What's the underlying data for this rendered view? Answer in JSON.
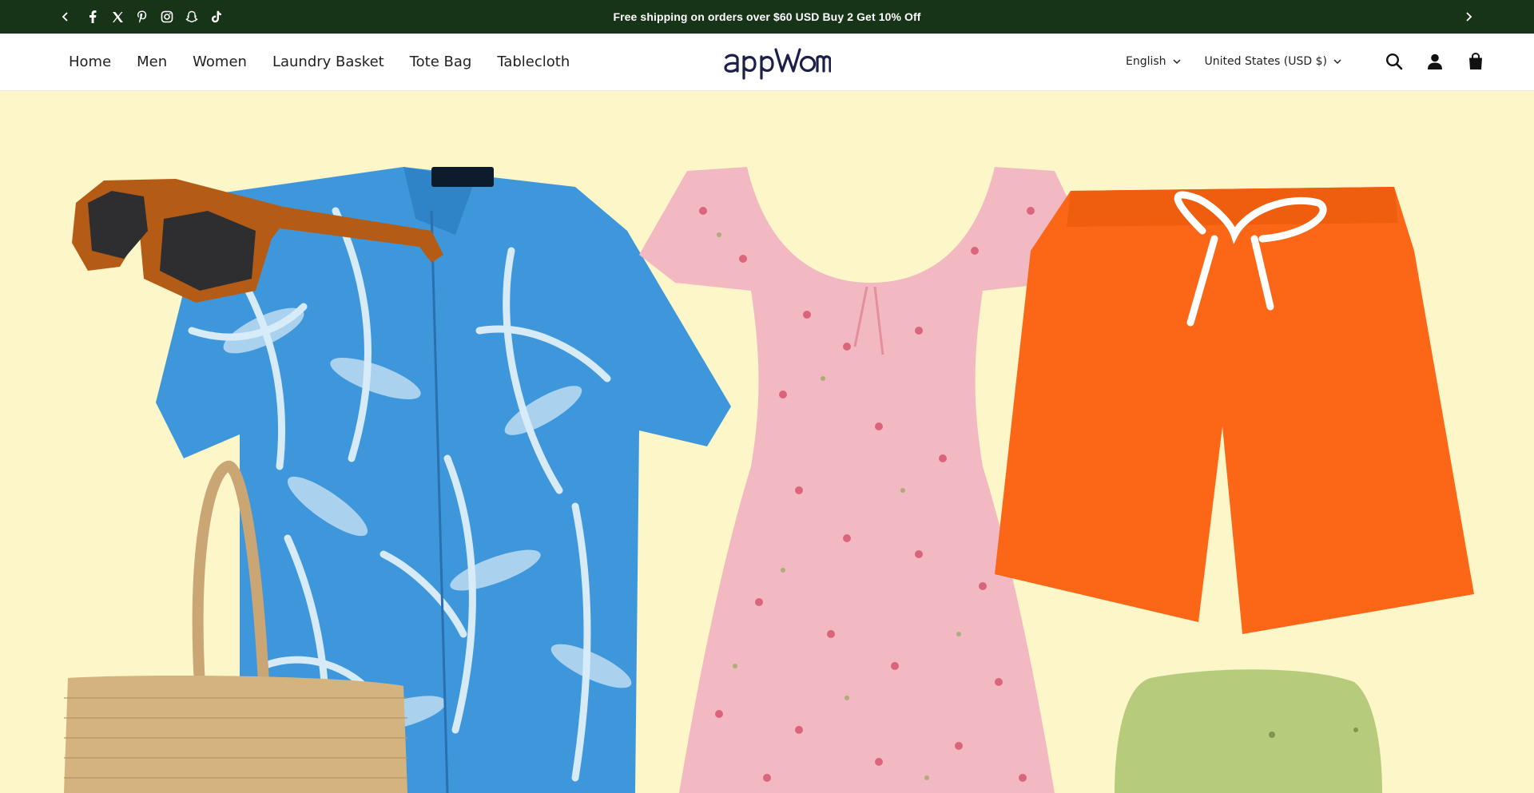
{
  "announcement": {
    "message": "Free shipping on orders over $60 USD Buy 2 Get 10% Off",
    "prev_icon": "chevron-left-icon",
    "next_icon": "chevron-right-icon",
    "socials": [
      "facebook-icon",
      "x-twitter-icon",
      "pinterest-icon",
      "instagram-icon",
      "snapchat-icon",
      "tiktok-icon"
    ],
    "background": "#173418"
  },
  "header": {
    "nav": [
      "Home",
      "Men",
      "Women",
      "Laundry Basket",
      "Tote Bag",
      "Tablecloth"
    ],
    "logo_text": "appwom",
    "language": "English",
    "currency": "United States (USD $)",
    "icons": [
      "search-icon",
      "account-icon",
      "cart-icon"
    ]
  },
  "hero": {
    "background": "#fdf6c9",
    "items": [
      "sunglasses",
      "hawaiian-shirt",
      "floral-dress",
      "orange-shorts",
      "straw-tote-bag",
      "green-bucket-hat"
    ]
  }
}
